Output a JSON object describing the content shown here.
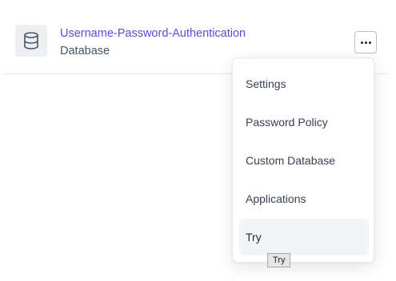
{
  "connection": {
    "name": "Username-Password-Authentication",
    "type": "Database",
    "icon": "database-icon"
  },
  "actions_button": {
    "icon": "more-horizontal-icon"
  },
  "menu": {
    "items": [
      {
        "label": "Settings"
      },
      {
        "label": "Password Policy"
      },
      {
        "label": "Custom Database"
      },
      {
        "label": "Applications"
      },
      {
        "label": "Try"
      }
    ],
    "hovered_index": 4
  },
  "tooltip": {
    "text": "Try"
  },
  "colors": {
    "link": "#5b4ce0",
    "icon_bg": "#eeeff2",
    "hover_bg": "#f3f4f6"
  }
}
